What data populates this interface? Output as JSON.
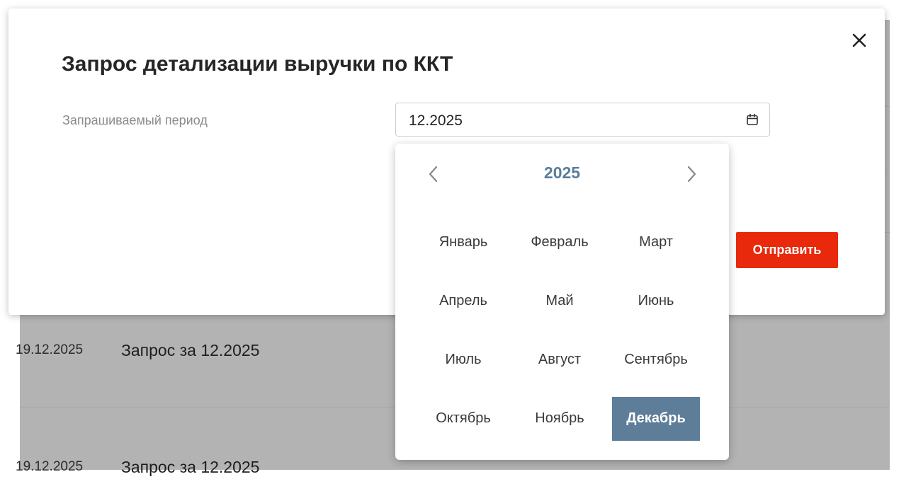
{
  "background": {
    "rows": [
      {
        "date": "19.12.2025",
        "text": "Запрос за 12.2025"
      },
      {
        "date": "19.12.2025",
        "text": "Запрос за 12.2025"
      }
    ]
  },
  "modal": {
    "title": "Запрос детализации выручки по ККТ",
    "close_icon": "close-icon",
    "period_label": "Запрашиваемый период",
    "period_value": "12.2025",
    "calendar_icon": "calendar-icon",
    "submit_label": "Отправить",
    "submit_color": "#e8290b"
  },
  "picker": {
    "year": "2025",
    "prev_icon": "chevron-left-icon",
    "next_icon": "chevron-right-icon",
    "selected_month": "Декабрь",
    "selected_color": "#5d7d98",
    "months": [
      "Январь",
      "Февраль",
      "Март",
      "Апрель",
      "Май",
      "Июнь",
      "Июль",
      "Август",
      "Сентябрь",
      "Октябрь",
      "Ноябрь",
      "Декабрь"
    ]
  }
}
